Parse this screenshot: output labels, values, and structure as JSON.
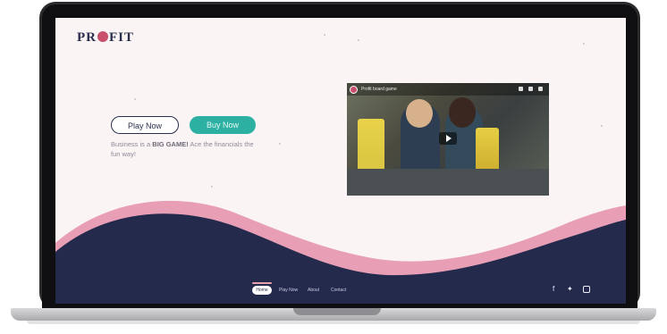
{
  "site": {
    "logo_text_left": "PR",
    "logo_text_right": "FIT"
  },
  "hero": {
    "play_button": "Play Now",
    "buy_button": "Buy Now",
    "tagline_before": "Business is a ",
    "tagline_bold": "BIG GAME!",
    "tagline_after": " Ace the financials the fun way!"
  },
  "video": {
    "title": "Profit board game"
  },
  "footer": {
    "nav": [
      "Home",
      "Play Now",
      "About",
      "Contact"
    ],
    "social": [
      "facebook-icon",
      "twitter-icon",
      "instagram-icon"
    ]
  },
  "colors": {
    "navy": "#232a4c",
    "pink": "#e89fb6",
    "teal": "#2bb0a2",
    "background": "#fbf4f5"
  }
}
